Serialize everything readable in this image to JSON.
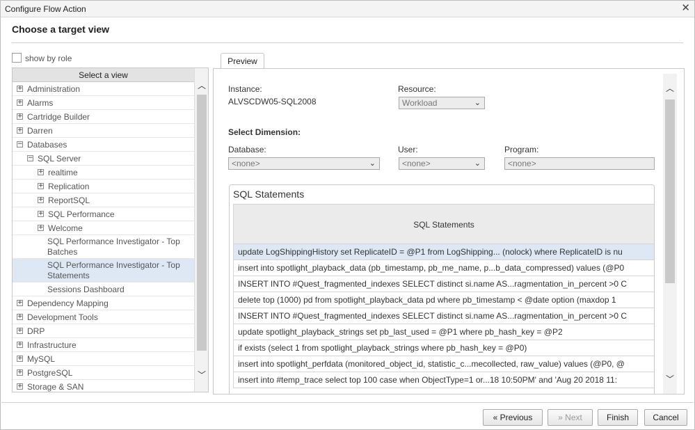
{
  "window": {
    "title": "Configure Flow Action",
    "close_glyph": "✕"
  },
  "heading": "Choose a target view",
  "show_by_role": {
    "label": "show by role",
    "checked": false
  },
  "tree": {
    "header": "Select a view",
    "items": [
      {
        "label": "Administration",
        "expander": "+",
        "level": 0
      },
      {
        "label": "Alarms",
        "expander": "+",
        "level": 0
      },
      {
        "label": "Cartridge Builder",
        "expander": "+",
        "level": 0
      },
      {
        "label": "Darren",
        "expander": "+",
        "level": 0
      },
      {
        "label": "Databases",
        "expander": "−",
        "level": 0
      },
      {
        "label": "SQL Server",
        "expander": "−",
        "level": 1
      },
      {
        "label": "realtime",
        "expander": "+",
        "level": 2
      },
      {
        "label": "Replication",
        "expander": "+",
        "level": 2
      },
      {
        "label": "ReportSQL",
        "expander": "+",
        "level": 2
      },
      {
        "label": "SQL Performance",
        "expander": "+",
        "level": 2
      },
      {
        "label": "Welcome",
        "expander": "+",
        "level": 2
      },
      {
        "label": "SQL Performance Investigator - Top Batches",
        "expander": "",
        "level": 3
      },
      {
        "label": "SQL Performance Investigator - Top Statements",
        "expander": "",
        "level": 3,
        "selected": true
      },
      {
        "label": "Sessions Dashboard",
        "expander": "",
        "level": 3
      },
      {
        "label": "Dependency Mapping",
        "expander": "+",
        "level": 0
      },
      {
        "label": "Development Tools",
        "expander": "+",
        "level": 0
      },
      {
        "label": "DRP",
        "expander": "+",
        "level": 0
      },
      {
        "label": "Infrastructure",
        "expander": "+",
        "level": 0
      },
      {
        "label": "MySQL",
        "expander": "+",
        "level": 0
      },
      {
        "label": "PostgreSQL",
        "expander": "+",
        "level": 0
      },
      {
        "label": "Storage & SAN",
        "expander": "+",
        "level": 0
      }
    ],
    "scroll_up_glyph": "︿",
    "scroll_down_glyph": "﹀"
  },
  "preview": {
    "tab_label": "Preview",
    "instance_label": "Instance:",
    "instance_value": "ALVSCDW05-SQL2008",
    "resource_label": "Resource:",
    "resource_value": "Workload",
    "dimension_heading": "Select Dimension:",
    "database_label": "Database:",
    "database_value": "<none>",
    "user_label": "User:",
    "user_value": "<none>",
    "program_label": "Program:",
    "program_value": "<none>",
    "chevron_glyph": "⌄",
    "sql": {
      "title": "SQL Statements",
      "column_header": "SQL Statements",
      "rows": [
        "update LogShippingHistory set ReplicateID = @P1 from LogShipping... (nolock) where ReplicateID is nu",
        "insert into spotlight_playback_data (pb_timestamp, pb_me_name, p...b_data_compressed) values (@P0",
        "INSERT INTO #Quest_fragmented_indexes SELECT distinct si.name AS...ragmentation_in_percent >0 C",
        "delete top (1000) pd from spotlight_playback_data pd where pb_timestamp < @date option (maxdop 1",
        "INSERT INTO #Quest_fragmented_indexes SELECT distinct si.name AS...ragmentation_in_percent >0 C",
        "update spotlight_playback_strings set pb_last_used = @P1 where pb_hash_key = @P2",
        "if exists (select 1 from spotlight_playback_strings where pb_hash_key = @P0)",
        "insert into spotlight_perfdata (monitored_object_id, statistic_c...mecollected, raw_value) values (@P0, @",
        "insert into #temp_trace select top 100 case when ObjectType=1 or...18 10:50PM' and 'Aug 20 2018 11:"
      ]
    }
  },
  "buttons": {
    "previous": "« Previous",
    "next": "» Next",
    "finish": "Finish",
    "cancel": "Cancel"
  }
}
